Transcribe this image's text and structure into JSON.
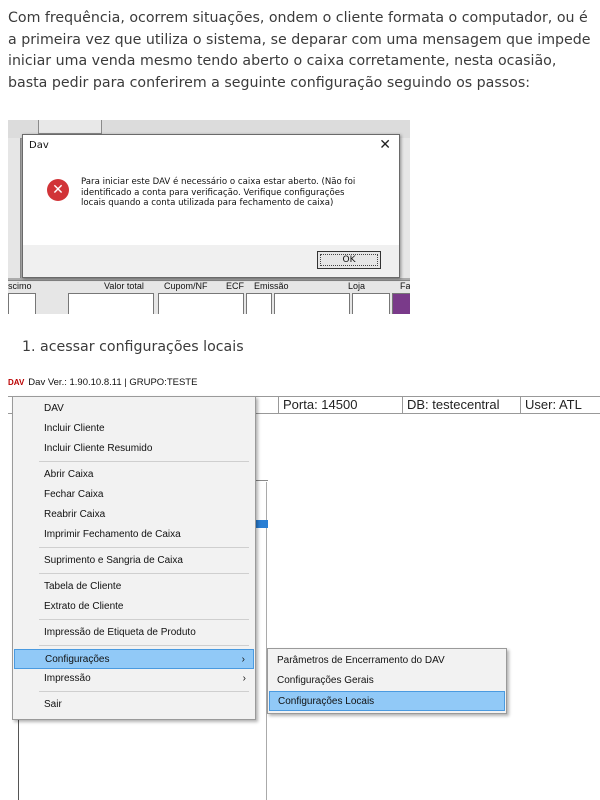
{
  "intro": "Com frequência, ocorrem situações, ondem o cliente formata o computador, ou é a primeira vez que utiliza o sistema, se deparar com uma mensagem que impede iniciar uma venda mesmo tendo aberto o caixa corretamente, nesta ocasião, basta pedir para conferirem a seguinte configuração seguindo os passos:",
  "dialog": {
    "title": "Dav",
    "close": "✕",
    "icon": "error-icon",
    "message": "Para iniciar este DAV é necessário o caixa estar aberto. (Não foi identificado a conta para verificação. Verifique configurações locais quando a conta utilizada para fechamento de caixa)",
    "ok": "OK"
  },
  "background_columns": [
    "scimo",
    "Valor total",
    "Cupom/NF",
    "ECF",
    "Emissão",
    "Loja",
    "Fa"
  ],
  "step1": "1. acessar configurações locais",
  "app": {
    "logo": "DAV",
    "title": "Dav Ver.: 1.90.10.8.11 | GRUPO:TESTE",
    "status": {
      "porta": "Porta: 14500",
      "db": "DB: testecentral",
      "user": "User: ATL"
    }
  },
  "menu": {
    "items": [
      "DAV",
      "Incluir Cliente",
      "Incluir Cliente Resumido",
      "Abrir Caixa",
      "Fechar Caixa",
      "Reabrir Caixa",
      "Imprimir Fechamento de Caixa",
      "Suprimento e Sangria de Caixa",
      "Tabela de Cliente",
      "Extrato de Cliente",
      "Impressão de Etiqueta de Produto",
      "Configurações",
      "Impressão",
      "Sair"
    ],
    "submenu_arrow": "›"
  },
  "submenu": {
    "items": [
      "Parâmetros de Encerramento do DAV",
      "Configurações Gerais",
      "Configurações Locais"
    ]
  },
  "colors": {
    "selection": "#91c9f7",
    "error": "#d13438"
  }
}
